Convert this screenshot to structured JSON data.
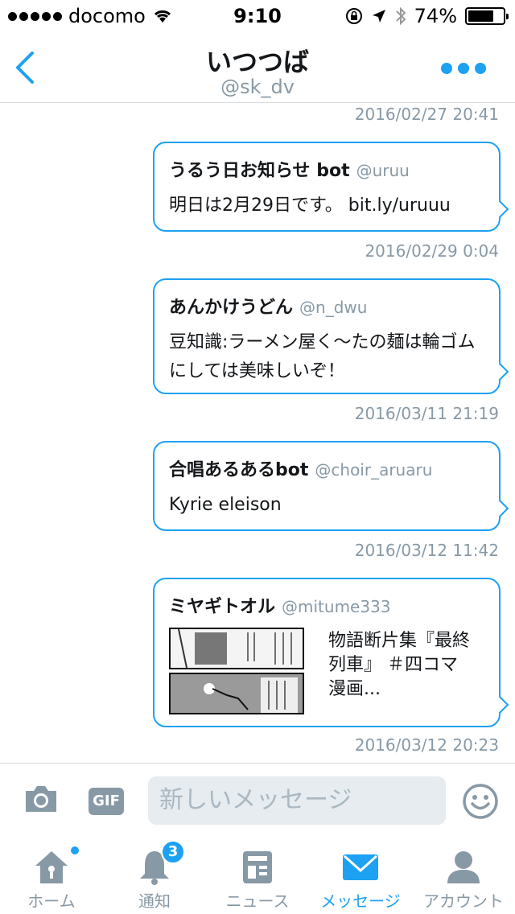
{
  "status_bar": {
    "carrier": "docomo",
    "time": "9:10",
    "battery": "74%",
    "battery_level": 0.74
  },
  "header": {
    "title": "いつつば",
    "subtitle": "@sk_dv"
  },
  "messages": [
    {
      "timestamp": "2016/02/27 20:41",
      "name": "うるう日お知らせ bot",
      "handle": "@uruu",
      "text": "明日は2月29日です。 bit.ly/uruuu"
    },
    {
      "timestamp": "2016/02/29 0:04",
      "name": "あんかけうどん",
      "handle": "@n_dwu",
      "text": "豆知識:ラーメン屋く〜たの麺は輪ゴムにしては美味しいぞ！"
    },
    {
      "timestamp": "2016/03/11 21:19",
      "name": "合唱あるあるbot",
      "handle": "@choir_aruaru",
      "text": "Kyrie eleison"
    },
    {
      "timestamp": "2016/03/12 11:42",
      "name": "ミヤギトオル",
      "handle": "@mitume333",
      "card_text": "物語断片集『最終列車』 ＃四コマ漫画..."
    }
  ],
  "last_timestamp": "2016/03/12 20:23",
  "compose": {
    "gif_label": "GIF",
    "placeholder": "新しいメッセージ"
  },
  "tabs": [
    {
      "label": "ホーム",
      "icon": "home-icon",
      "dot": true
    },
    {
      "label": "通知",
      "icon": "bell-icon",
      "badge": "3"
    },
    {
      "label": "ニュース",
      "icon": "news-icon"
    },
    {
      "label": "メッセージ",
      "icon": "envelope-icon",
      "active": true
    },
    {
      "label": "アカウント",
      "icon": "person-icon"
    }
  ],
  "colors": {
    "accent": "#1da1f2",
    "muted": "#8899a6"
  }
}
